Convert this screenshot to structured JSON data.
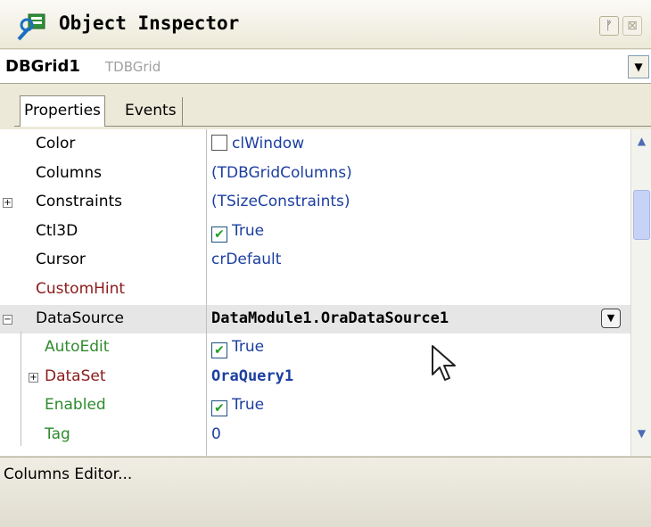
{
  "window": {
    "title": "Object Inspector",
    "pin_glyph": "ᚠ",
    "close_glyph": "⊠"
  },
  "component": {
    "name": "DBGrid1",
    "type": "TDBGrid",
    "dropdown_glyph": "▼"
  },
  "tabs": [
    {
      "label": "Properties",
      "active": true
    },
    {
      "label": "Events",
      "active": false
    }
  ],
  "properties": [
    {
      "name": "Color",
      "value": "clWindow",
      "kind": "color",
      "name_color": "#000000"
    },
    {
      "name": "Columns",
      "value": "(TDBGridColumns)",
      "kind": "text",
      "name_color": "#000000"
    },
    {
      "name": "Constraints",
      "value": "(TSizeConstraints)",
      "kind": "text",
      "name_color": "#000000",
      "expander": "+"
    },
    {
      "name": "Ctl3D",
      "value": "True",
      "kind": "check",
      "name_color": "#000000"
    },
    {
      "name": "Cursor",
      "value": "crDefault",
      "kind": "text",
      "name_color": "#000000"
    },
    {
      "name": "CustomHint",
      "value": "",
      "kind": "text",
      "name_color": "#8b1a1a"
    },
    {
      "name": "DataSource",
      "value": "DataModule1.OraDataSource1",
      "kind": "bold-drop",
      "name_color": "#000000",
      "expander": "−",
      "selected": true
    },
    {
      "name": "AutoEdit",
      "value": "True",
      "kind": "check",
      "name_color": "#2e8b2e",
      "indent": 1
    },
    {
      "name": "DataSet",
      "value": "OraQuery1",
      "kind": "bold",
      "name_color": "#8b1a1a",
      "indent": 1,
      "expander": "+"
    },
    {
      "name": "Enabled",
      "value": "True",
      "kind": "check",
      "name_color": "#2e8b2e",
      "indent": 1
    },
    {
      "name": "Tag",
      "value": "0",
      "kind": "text",
      "name_color": "#2e8b2e",
      "indent": 1
    }
  ],
  "check_glyph": "✔",
  "status": {
    "text": "Columns Editor..."
  }
}
